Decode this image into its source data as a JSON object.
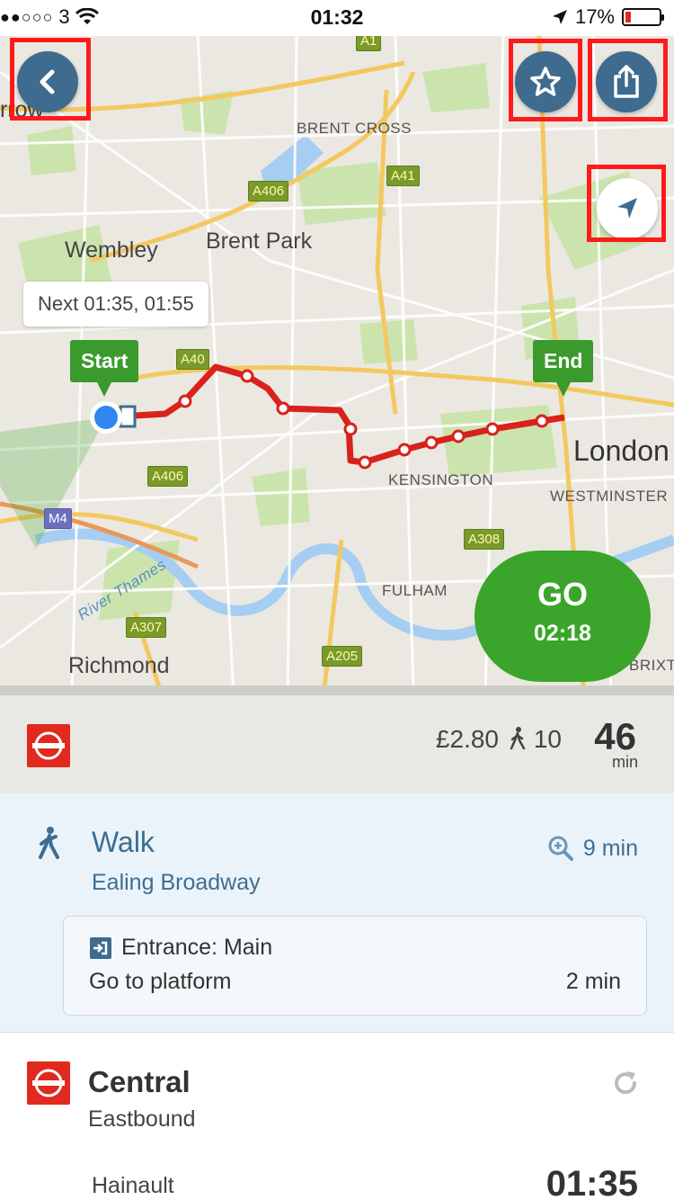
{
  "status_bar": {
    "signal": "●●○○○",
    "carrier": "3",
    "time": "01:32",
    "battery": "17%"
  },
  "map": {
    "labels": {
      "brent_cross": "BRENT CROSS",
      "wembley": "Wembley",
      "brent_park": "Brent Park",
      "london": "London",
      "kensington": "KENSINGTON",
      "westminster": "WESTMINSTER",
      "fulham": "FULHAM",
      "richmond": "Richmond",
      "brixton": "BRIXT",
      "row": "rrow",
      "river": "River Thames"
    },
    "roads": {
      "a1": "A1",
      "a41": "A41",
      "a406_top": "A406",
      "a40": "A40",
      "a406_bottom": "A406",
      "m4": "M4",
      "a307": "A307",
      "a205": "A205",
      "a308": "A308"
    },
    "next_departures": "Next 01:35, 01:55",
    "start_pin": "Start",
    "end_pin": "End",
    "go_button": {
      "label": "GO",
      "time": "02:18"
    },
    "icons": {
      "back": "chevron-left-icon",
      "favorite": "star-icon",
      "share": "share-icon",
      "locate": "location-arrow-icon"
    }
  },
  "summary": {
    "price": "£2.80",
    "walk_minutes": "10",
    "total": "46",
    "total_unit": "min"
  },
  "walk": {
    "title": "Walk",
    "station": "Ealing Broadway",
    "duration": "9 min",
    "entrance": "Entrance: Main",
    "instruction": "Go to platform",
    "instruction_time": "2 min"
  },
  "central": {
    "line": "Central",
    "direction": "Eastbound",
    "destination": "Hainault",
    "departure": "01:35"
  },
  "colors": {
    "route": "#d9221c",
    "go": "#3aa52a",
    "button": "#3f6b8e",
    "highlight": "#ff1a1a",
    "tfl": "#e0291f"
  }
}
